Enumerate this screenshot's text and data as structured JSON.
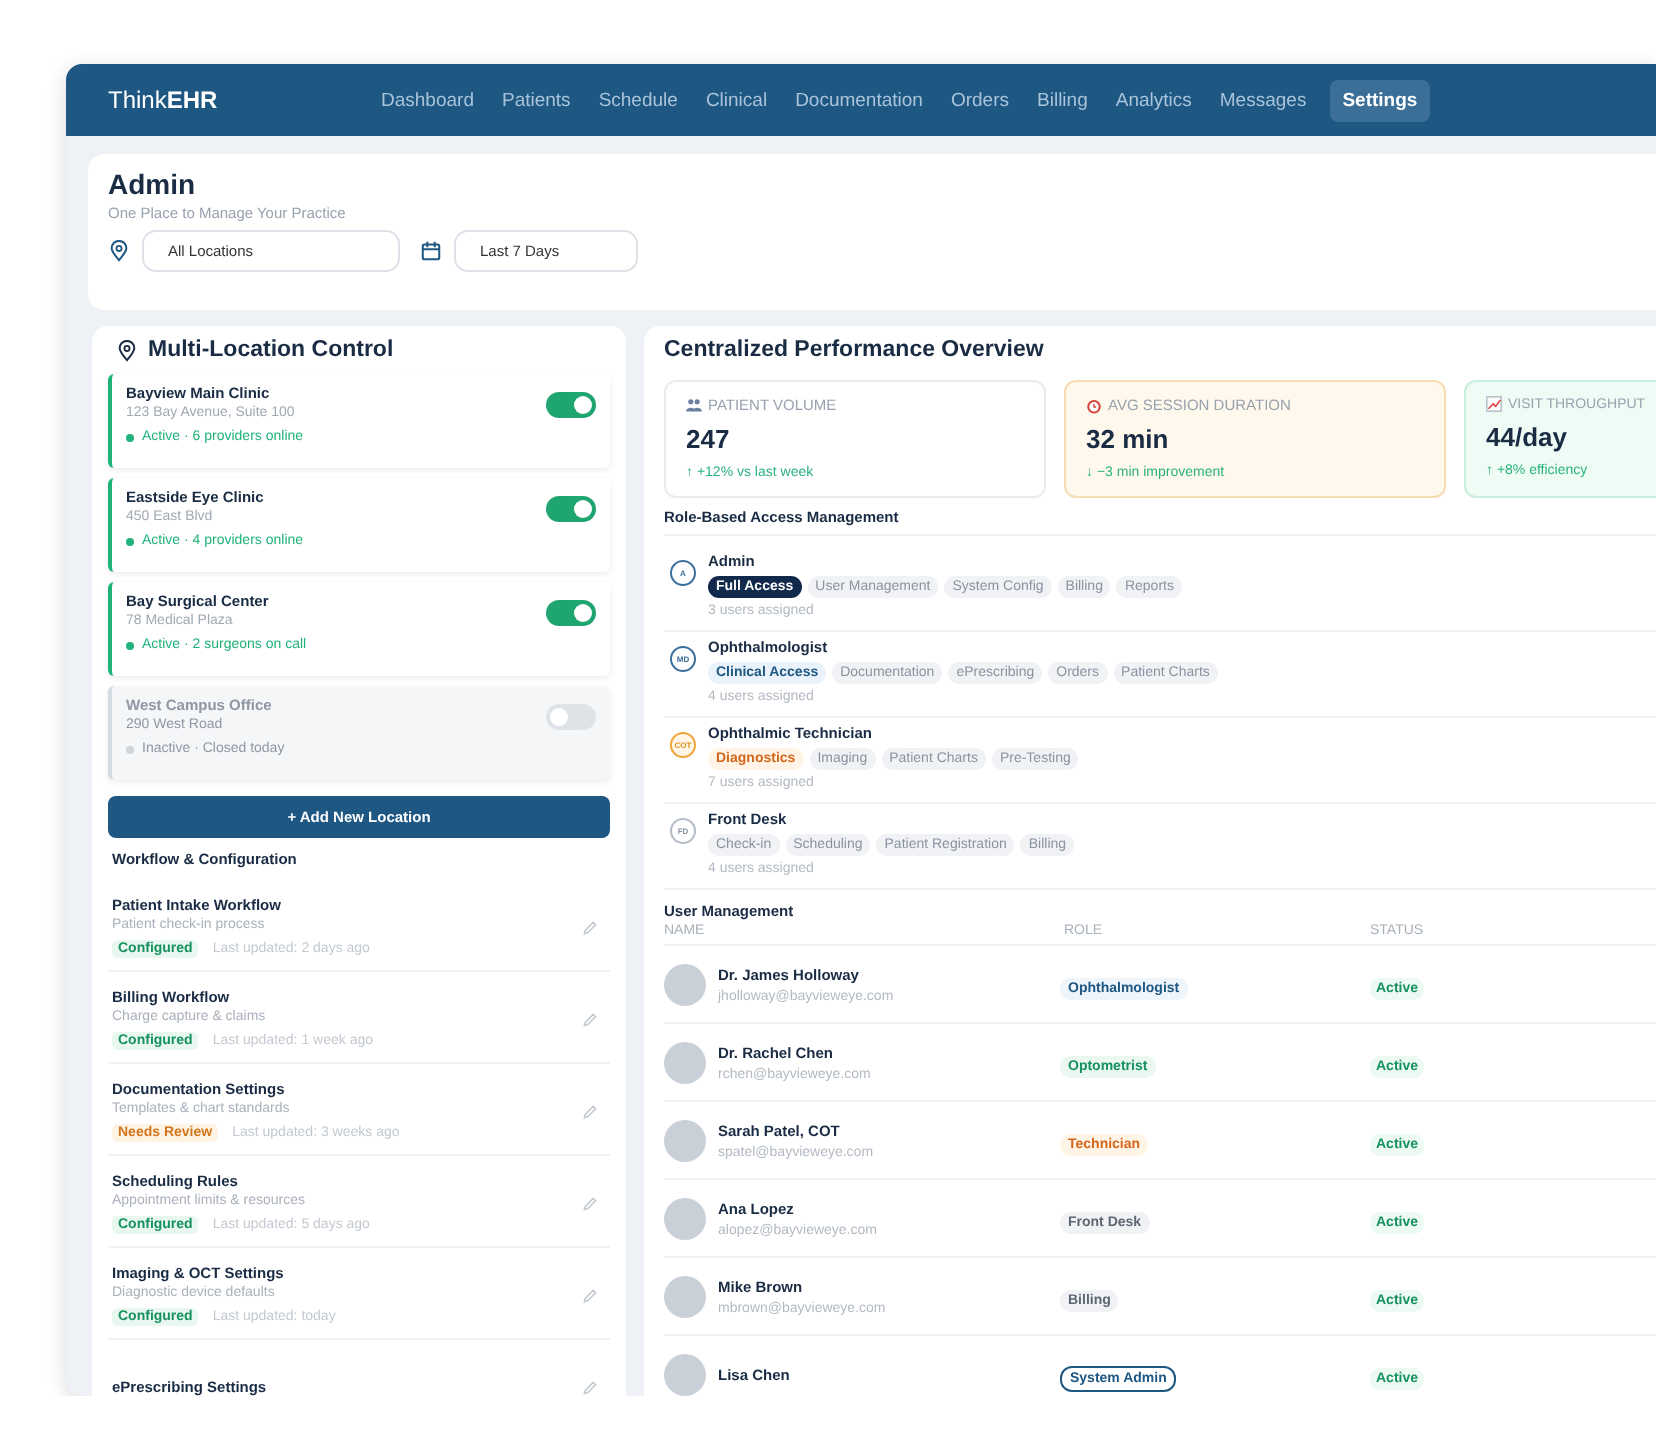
{
  "app": {
    "logo": "Think**EHR**"
  },
  "nav": [
    {
      "label": "Dashboard",
      "selected": false
    },
    {
      "label": "Patients",
      "selected": false
    },
    {
      "label": "Schedule",
      "selected": false
    },
    {
      "label": "Clinical",
      "selected": false
    },
    {
      "label": "Documentation",
      "selected": false
    },
    {
      "label": "Orders",
      "selected": false
    },
    {
      "label": "Billing",
      "selected": false
    },
    {
      "label": "Analytics",
      "selected": false
    },
    {
      "label": "Messages",
      "selected": false
    },
    {
      "label": "Settings",
      "selected": true
    }
  ],
  "header": {
    "title": "Admin",
    "subtitle": "One Place to Manage Your Practice",
    "filters": [
      {
        "kind": "location",
        "value": "All Locations"
      },
      {
        "kind": "date",
        "value": "Last 7 Days"
      }
    ]
  },
  "locations": {
    "title": "Multi-Location Control",
    "items": [
      {
        "name": "Bayview Main Clinic",
        "address": "123 Bay Avenue, Suite 100",
        "status": "Active · 6 providers online",
        "on": true
      },
      {
        "name": "Eastside Eye Clinic",
        "address": "450 East Blvd",
        "status": "Active · 4 providers online",
        "on": true
      },
      {
        "name": "Bay Surgical Center",
        "address": "78 Medical Plaza",
        "status": "Active · 2 surgeons on call",
        "on": true
      },
      {
        "name": "West Campus Office",
        "address": "290 West Road",
        "status": "Inactive · Closed today",
        "on": false
      }
    ],
    "add_button": "+ Add New Location"
  },
  "workflow": {
    "title": "Workflow & Configuration",
    "items": [
      {
        "name": "Patient Intake Workflow",
        "description": "Patient check-in process",
        "status": {
          "label": "Configured",
          "kind": "ok"
        },
        "updated": "Last updated: 2 days ago"
      },
      {
        "name": "Billing Workflow",
        "description": "Charge capture & claims",
        "status": {
          "label": "Configured",
          "kind": "ok"
        },
        "updated": "Last updated: 1 week ago"
      },
      {
        "name": "Documentation Settings",
        "description": "Templates & chart standards",
        "status": {
          "label": "Needs Review",
          "kind": "review"
        },
        "updated": "Last updated: 3 weeks ago"
      },
      {
        "name": "Scheduling Rules",
        "description": "Appointment limits & resources",
        "status": {
          "label": "Configured",
          "kind": "ok"
        },
        "updated": "Last updated: 5 days ago"
      },
      {
        "name": "Imaging & OCT Settings",
        "description": "Diagnostic device defaults",
        "status": {
          "label": "Configured",
          "kind": "ok"
        },
        "updated": "Last updated: today"
      },
      {
        "name": "ePrescribing Settings"
      }
    ]
  },
  "performance": {
    "title": "Centralized Performance Overview",
    "stats": [
      {
        "kind": "neutral",
        "label": "PATIENT VOLUME",
        "value": "247",
        "change": "↑ +12% vs last week"
      },
      {
        "kind": "warning",
        "label": "AVG SESSION DURATION",
        "value": "32 min",
        "change": "↓ −3 min improvement"
      },
      {
        "kind": "success",
        "label": "VISIT THROUGHPUT",
        "value": "44/day",
        "change": "↑ +8% efficiency"
      }
    ]
  },
  "roles": {
    "title": "Role-Based Access Management",
    "items": [
      {
        "kind": "admin",
        "badge": "A",
        "name": "Admin",
        "permissions": [
          {
            "label": "Full Access",
            "primary": true
          },
          {
            "label": "User Management",
            "primary": false
          },
          {
            "label": "System Config",
            "primary": false
          },
          {
            "label": "Billing",
            "primary": false
          },
          {
            "label": "Reports",
            "primary": false
          }
        ],
        "users": "3 users assigned"
      },
      {
        "kind": "clinical",
        "badge": "MD",
        "name": "Ophthalmologist",
        "permissions": [
          {
            "label": "Clinical Access",
            "primary": true
          },
          {
            "label": "Documentation",
            "primary": false
          },
          {
            "label": "ePrescribing",
            "primary": false
          },
          {
            "label": "Orders",
            "primary": false
          },
          {
            "label": "Patient Charts",
            "primary": false
          }
        ],
        "users": "4 users assigned"
      },
      {
        "kind": "technical",
        "badge": "COT",
        "name": "Ophthalmic Technician",
        "permissions": [
          {
            "label": "Diagnostics",
            "primary": true
          },
          {
            "label": "Imaging",
            "primary": false
          },
          {
            "label": "Patient Charts",
            "primary": false
          },
          {
            "label": "Pre-Testing",
            "primary": false
          }
        ],
        "users": "7 users assigned"
      },
      {
        "kind": "staff",
        "badge": "FD",
        "name": "Front Desk",
        "permissions": [
          {
            "label": "Check-in",
            "primary": false
          },
          {
            "label": "Scheduling",
            "primary": false
          },
          {
            "label": "Patient Registration",
            "primary": false
          },
          {
            "label": "Billing",
            "primary": false
          }
        ],
        "users": "4 users assigned"
      }
    ]
  },
  "users": {
    "title": "User Management",
    "columns": [
      "NAME",
      "ROLE",
      "STATUS"
    ],
    "rows": [
      {
        "name": "Dr. James Holloway",
        "email": "jholloway@bayvieweye.com",
        "role": {
          "label": "Ophthalmologist",
          "kind": "blue"
        },
        "status": "Active"
      },
      {
        "name": "Dr. Rachel Chen",
        "email": "rchen@bayvieweye.com",
        "role": {
          "label": "Optometrist",
          "kind": "green"
        },
        "status": "Active"
      },
      {
        "name": "Sarah Patel, COT",
        "email": "spatel@bayvieweye.com",
        "role": {
          "label": "Technician",
          "kind": "orange"
        },
        "status": "Active"
      },
      {
        "name": "Ana Lopez",
        "email": "alopez@bayvieweye.com",
        "role": {
          "label": "Front Desk",
          "kind": "grey"
        },
        "status": "Active"
      },
      {
        "name": "Mike Brown",
        "email": "mbrown@bayvieweye.com",
        "role": {
          "label": "Billing",
          "kind": "grey"
        },
        "status": "Active"
      },
      {
        "name": "Lisa Chen",
        "role": {
          "label": "System Admin",
          "kind": "outline"
        },
        "status": "Active"
      }
    ]
  }
}
